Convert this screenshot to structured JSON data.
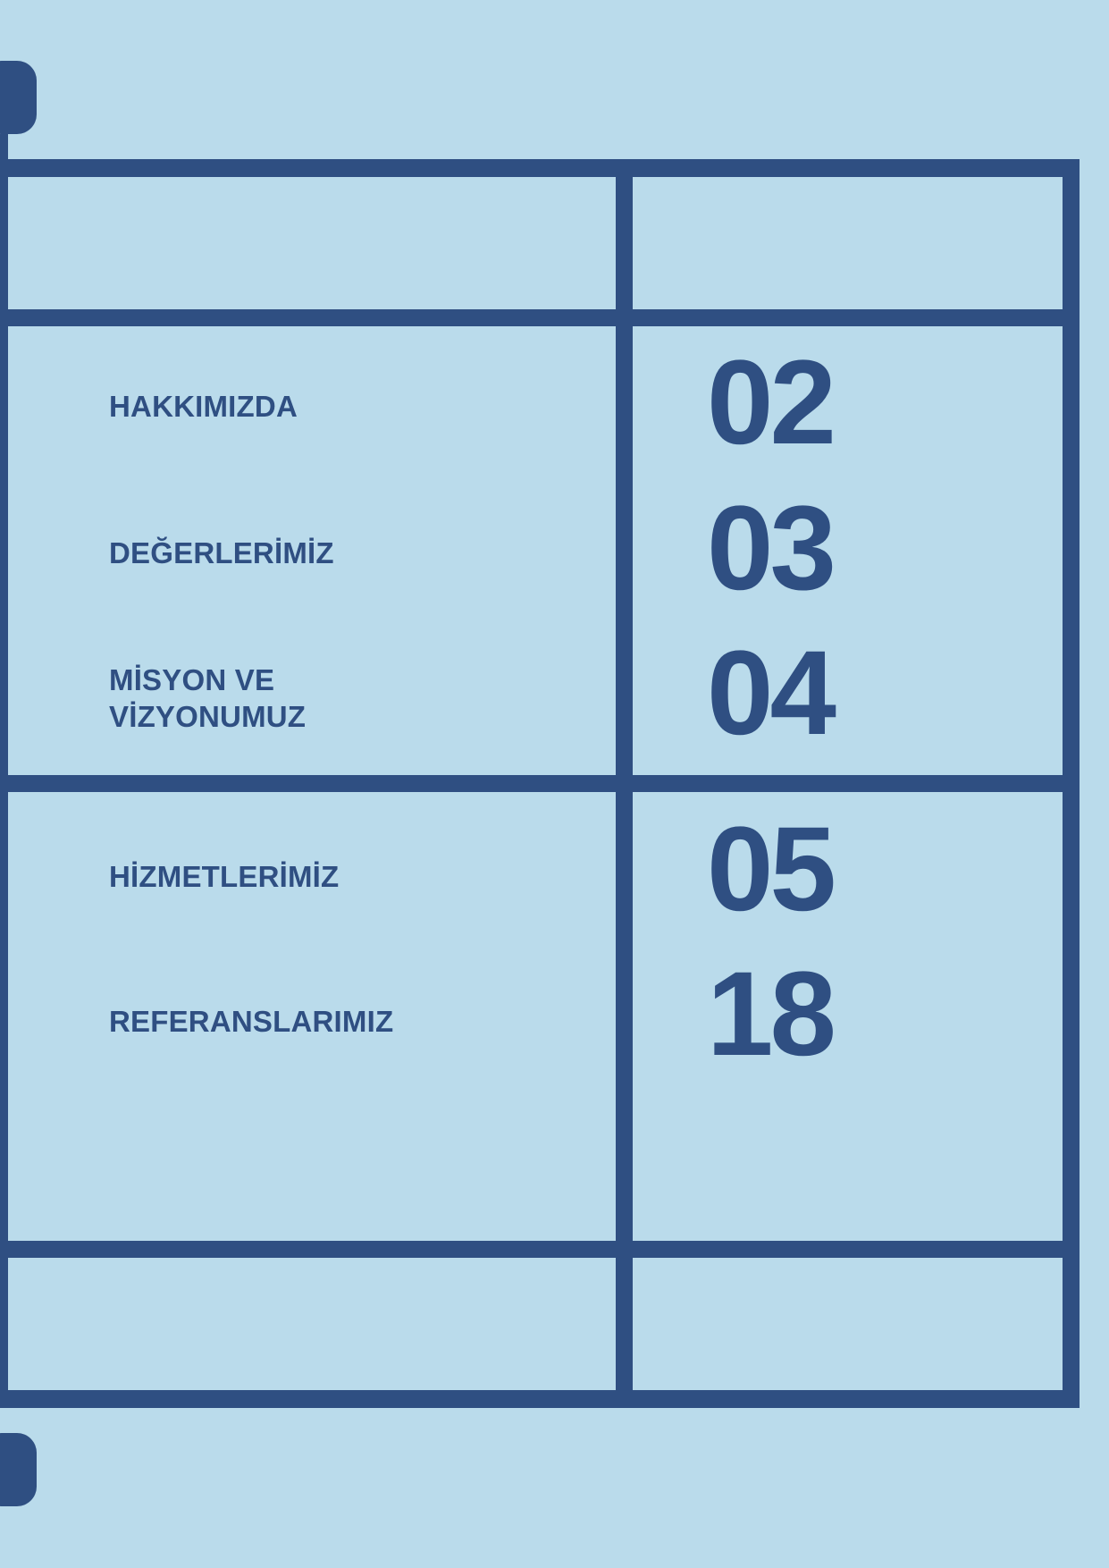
{
  "colors": {
    "background": "#badbeb",
    "accent": "#2f4f82"
  },
  "contents": {
    "items": [
      {
        "label": "HAKKIMIZDA",
        "page": "02"
      },
      {
        "label": "DEĞERLERİMİZ",
        "page": "03"
      },
      {
        "label": "MİSYON VE\nVİZYONUMUZ",
        "page": "04"
      },
      {
        "label": "HİZMETLERİMİZ",
        "page": "05"
      },
      {
        "label": "REFERANSLARIMIZ",
        "page": "18"
      }
    ]
  }
}
